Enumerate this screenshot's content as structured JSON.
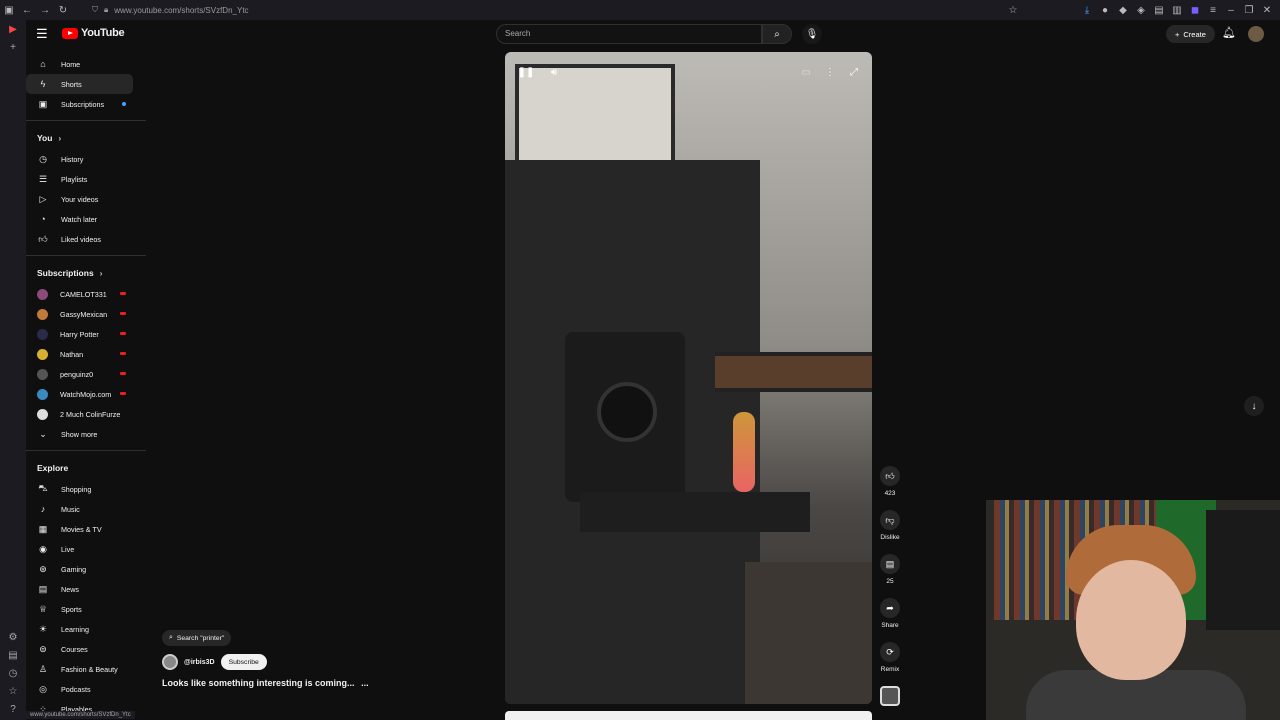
{
  "browser": {
    "url": "www.youtube.com/shorts/SVzfDn_Ytc",
    "status_url": "www.youtube.com/shorts/SVzfDn_Ytc"
  },
  "header": {
    "logo_text": "YouTube",
    "search_placeholder": "Search",
    "create_label": "Create"
  },
  "sidebar": {
    "main": [
      {
        "label": "Home",
        "icon": "home-icon"
      },
      {
        "label": "Shorts",
        "icon": "shorts-icon",
        "active": true
      },
      {
        "label": "Subscriptions",
        "icon": "subscriptions-icon"
      }
    ],
    "you_heading": "You",
    "you": [
      {
        "label": "History",
        "icon": "history-icon"
      },
      {
        "label": "Playlists",
        "icon": "playlists-icon"
      },
      {
        "label": "Your videos",
        "icon": "your-videos-icon"
      },
      {
        "label": "Watch later",
        "icon": "watch-later-icon"
      },
      {
        "label": "Liked videos",
        "icon": "liked-videos-icon"
      }
    ],
    "subs_heading": "Subscriptions",
    "subs": [
      {
        "label": "CAMELOT331",
        "color": "#8a4a7a"
      },
      {
        "label": "GassyMexican",
        "color": "#c07a3a"
      },
      {
        "label": "Harry Potter",
        "color": "#2a2a4a"
      },
      {
        "label": "Nathan",
        "color": "#d8b030"
      },
      {
        "label": "penguinz0",
        "color": "#555555"
      },
      {
        "label": "WatchMojo.com",
        "color": "#3a8ac0"
      },
      {
        "label": "2 Much ColinFurze",
        "color": "#dddddd"
      }
    ],
    "show_more": "Show more",
    "explore_heading": "Explore",
    "explore": [
      {
        "label": "Shopping",
        "icon": "shopping-icon"
      },
      {
        "label": "Music",
        "icon": "music-icon"
      },
      {
        "label": "Movies & TV",
        "icon": "movies-icon"
      },
      {
        "label": "Live",
        "icon": "live-icon"
      },
      {
        "label": "Gaming",
        "icon": "gaming-icon"
      },
      {
        "label": "News",
        "icon": "news-icon"
      },
      {
        "label": "Sports",
        "icon": "sports-icon"
      },
      {
        "label": "Learning",
        "icon": "learning-icon"
      },
      {
        "label": "Courses",
        "icon": "courses-icon"
      },
      {
        "label": "Fashion & Beauty",
        "icon": "fashion-icon"
      },
      {
        "label": "Podcasts",
        "icon": "podcasts-icon"
      },
      {
        "label": "Playables",
        "icon": "playables-icon"
      }
    ]
  },
  "short": {
    "search_chip": "Search \"printer\"",
    "channel": "@irbis3D",
    "subscribe": "Subscribe",
    "title": "Looks like something interesting is coming...",
    "more": "...",
    "likes": "423",
    "dislike": "Dislike",
    "comments": "25",
    "share": "Share",
    "remix": "Remix"
  }
}
